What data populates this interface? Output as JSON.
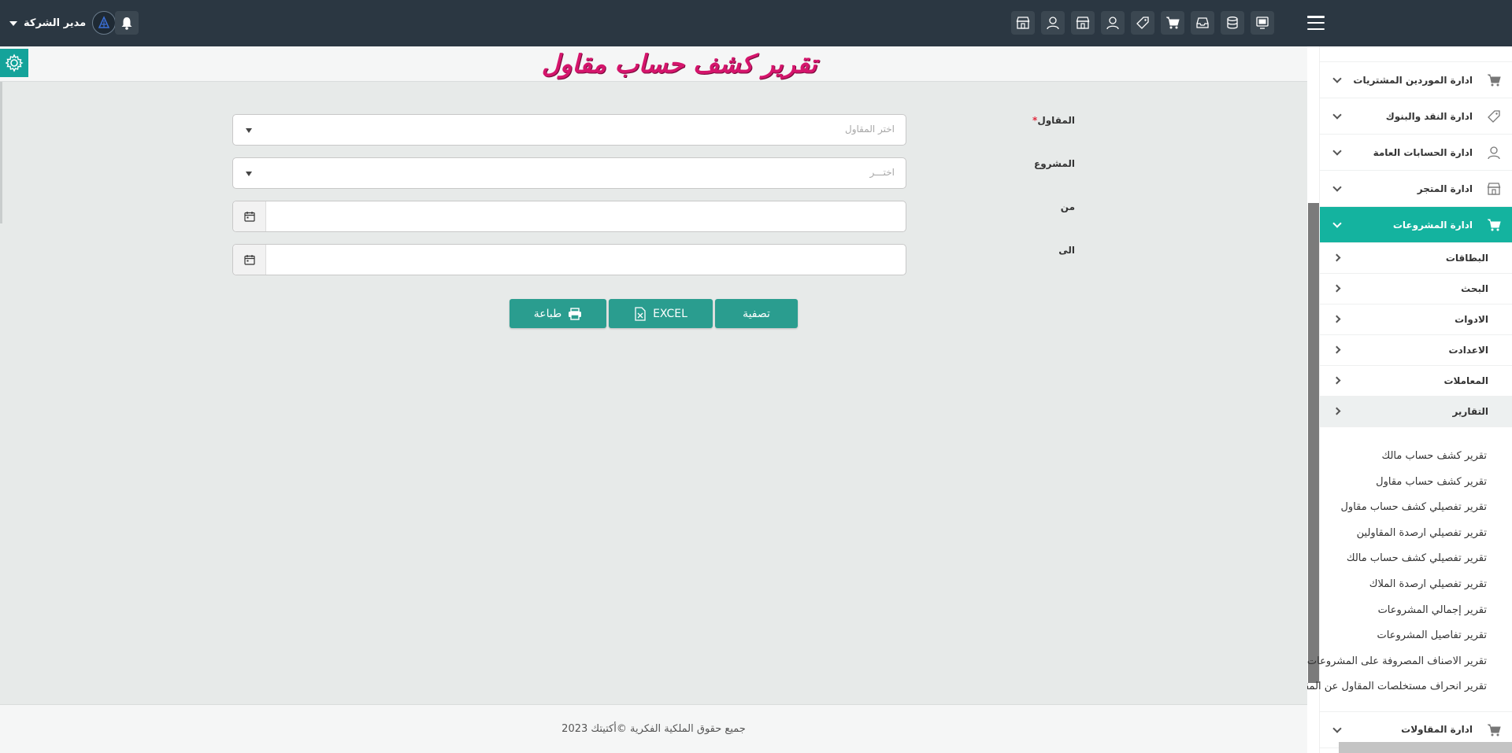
{
  "header": {
    "user_name": "مدير الشركة",
    "toolbar_icons": [
      "monitor-icon",
      "database-icon",
      "inbox-icon",
      "cart-icon",
      "tag-icon",
      "user-icon",
      "store-icon",
      "user-icon",
      "store-icon"
    ]
  },
  "page": {
    "title": "تقرير كشف حساب مقاول"
  },
  "form": {
    "contractor": {
      "label": "المقاول",
      "required_mark": "*",
      "placeholder": "اختر المقاول"
    },
    "project": {
      "label": "المشروع",
      "placeholder": "اختـــر"
    },
    "from": {
      "label": "من",
      "value": ""
    },
    "to": {
      "label": "الى",
      "value": ""
    }
  },
  "buttons": {
    "filter": "تصفية",
    "excel": "EXCEL",
    "print": "طباعة"
  },
  "footer": {
    "text": "جميع حقوق الملكية الفكرية ©أكتيتك 2023"
  },
  "sidebar": {
    "items": [
      {
        "label": "ادارة الموردين المشتريات",
        "icon": "cart-icon"
      },
      {
        "label": "ادارة النقد والبنوك",
        "icon": "tag-icon"
      },
      {
        "label": "ادارة الحسابات العامة",
        "icon": "user-icon"
      },
      {
        "label": "ادارة المتجر",
        "icon": "store-icon"
      },
      {
        "label": "ادارة المشروعات",
        "icon": "cart-icon",
        "active": true
      }
    ],
    "subitems": [
      "البطاقات",
      "البحث",
      "الادوات",
      "الاعدادت",
      "المعاملات",
      "التقارير"
    ],
    "reports": [
      "تقرير كشف حساب مالك",
      "تقرير كشف حساب مقاول",
      "تقرير تفصيلي كشف حساب مقاول",
      "تقرير تفصيلي ارصدة المقاولين",
      "تقرير تفصيلي كشف حساب مالك",
      "تقرير تفصيلي ارصدة الملاك",
      "تقرير إجمالي المشروعات",
      "تقرير تفاصيل المشروعات",
      "تقرير الاصناف المصروفة على المشروعات",
      "تقرير انحراف مستخلصات المقاول عن المقايسة"
    ],
    "last_item": {
      "label": "ادارة المقاولات",
      "icon": "cart-icon"
    }
  }
}
